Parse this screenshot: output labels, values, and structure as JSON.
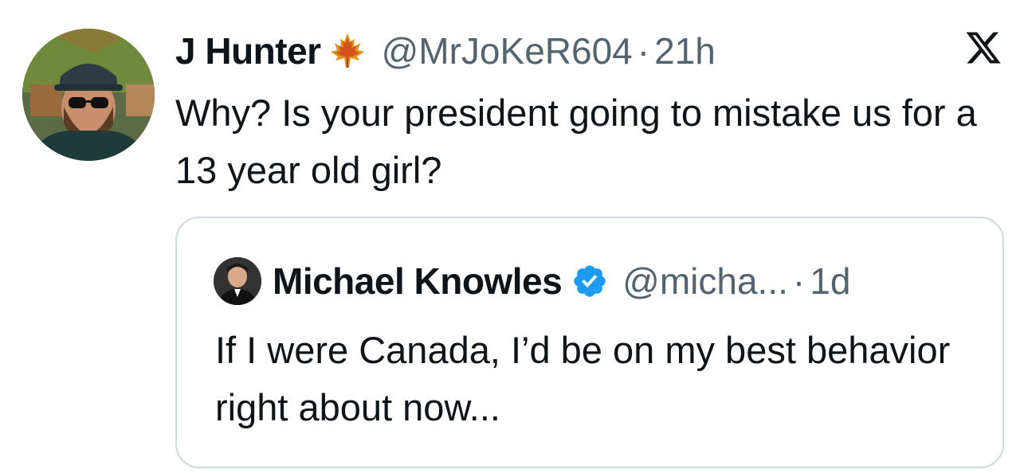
{
  "tweet": {
    "author_name": "J Hunter",
    "author_badge_icon": "maple-leaf-icon",
    "handle": "@MrJoKeR604",
    "separator": "·",
    "time": "21h",
    "text": "Why? Is your president going to mistake us for a 13 year old girl?",
    "platform_icon": "x-logo-icon"
  },
  "quoted_tweet": {
    "author_name": "Michael Knowles",
    "verified_icon": "verified-badge-icon",
    "handle": "@micha...",
    "separator": "·",
    "time": "1d",
    "text": "If I were Canada, I’d be on my best behavior right about now..."
  },
  "colors": {
    "text": "#0f1419",
    "secondary": "#536471",
    "border": "#cfd9de",
    "verified_blue": "#1d9bf0",
    "maple_leaf": "#e8a020"
  }
}
